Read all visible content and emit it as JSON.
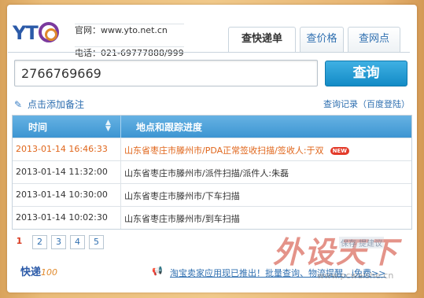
{
  "header": {
    "site_line": "官网：www.yto.net.cn",
    "phone_line": "电话：021-69777888/999",
    "logo_text": "YT"
  },
  "tabs": [
    {
      "label": "查快递单"
    },
    {
      "label": "查价格"
    },
    {
      "label": "查网点"
    }
  ],
  "search": {
    "value": "2766769669",
    "button_label": "查询"
  },
  "links": {
    "add_note": "点击添加备注",
    "history": "查询记录（百度登陆）"
  },
  "table": {
    "headers": [
      "时间",
      "地点和跟踪进度"
    ],
    "rows": [
      {
        "time": "2013-01-14 16:46:33",
        "desc": "山东省枣庄市滕州市/PDA正常签收扫描/签收人:于双",
        "badge": "NEW"
      },
      {
        "time": "2013-01-14 11:32:00",
        "desc": "山东省枣庄市滕州市/派件扫描/派件人:朱磊"
      },
      {
        "time": "2013-01-14 10:30:00",
        "desc": "山东省枣庄市滕州市/下车扫描"
      },
      {
        "time": "2013-01-14 10:02:30",
        "desc": "山东省枣庄市滕州市/到车扫描"
      }
    ]
  },
  "pagination": [
    "1",
    "2",
    "3",
    "4",
    "5"
  ],
  "footer": {
    "logo": "快递",
    "logo_sub": "100",
    "promo": "淘宝卖家应用现已推出！批量查询、物流提醒，i免费>>"
  },
  "watermark": {
    "main": "外设天下",
    "small": "保存 提建议",
    "url": "www.pcwaishe.cn"
  },
  "colors": {
    "accent_blue": "#2f6fb0",
    "latest_orange": "#e0661b",
    "header_blue": "#3d95d2",
    "button_blue": "#138bc6"
  }
}
